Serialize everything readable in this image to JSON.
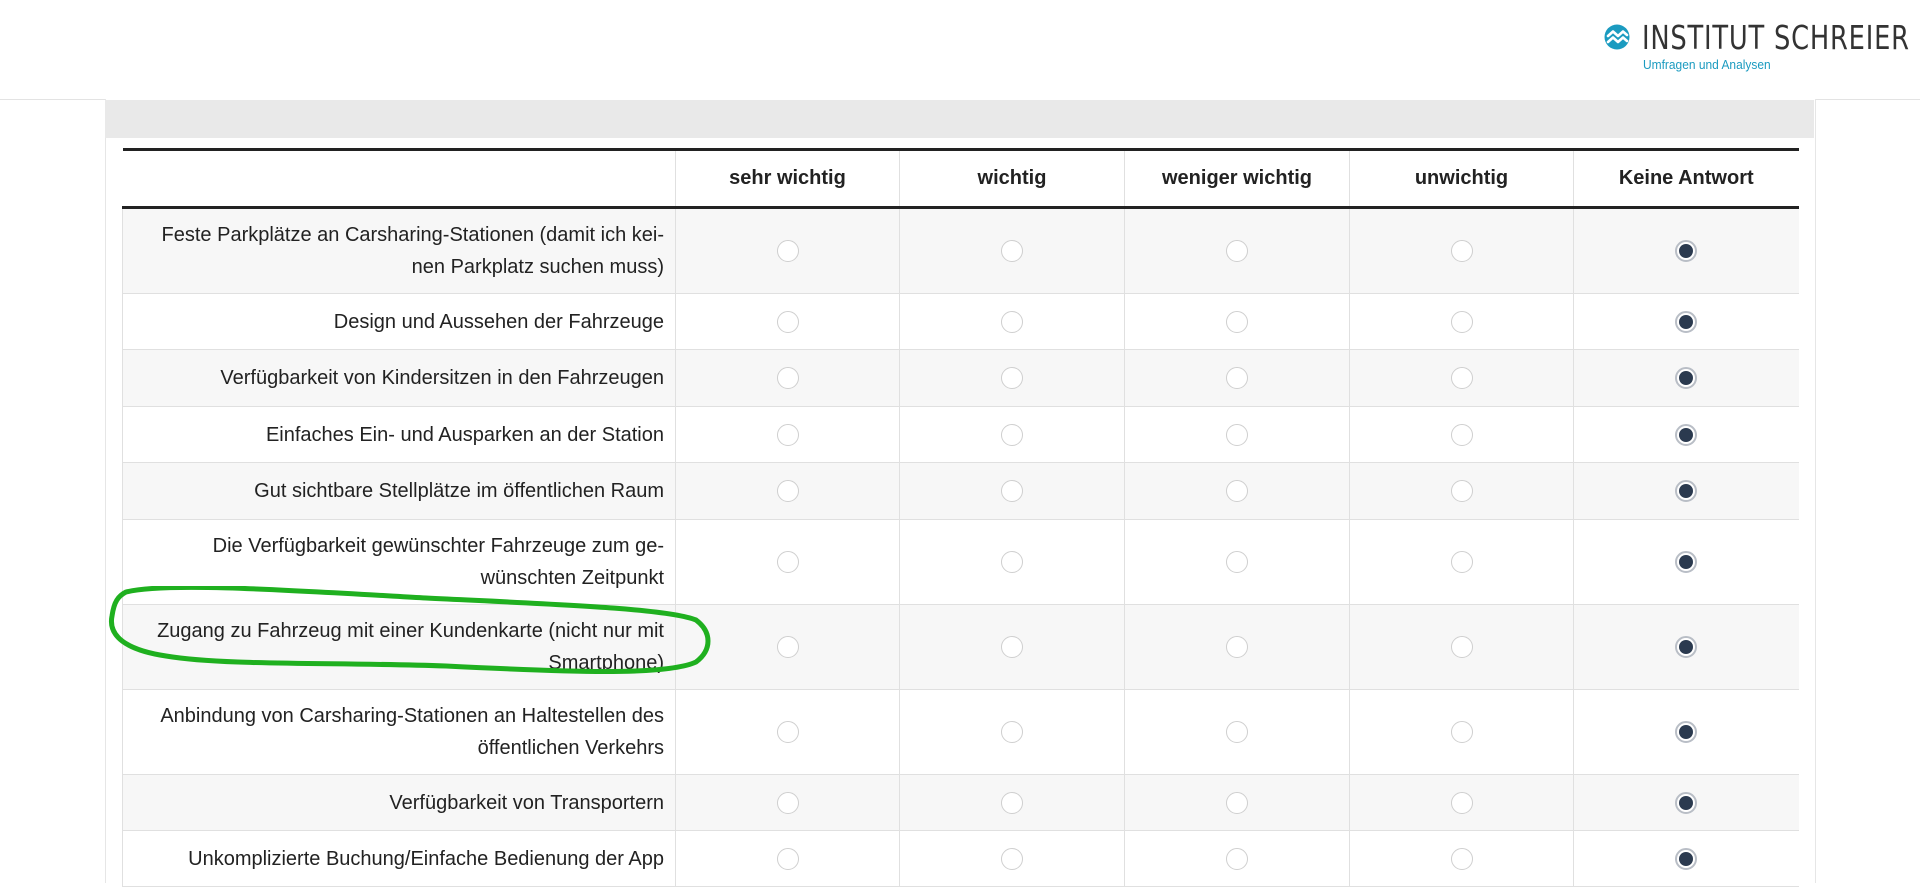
{
  "brand": {
    "name": "INSTITUT SCHREIER",
    "tagline": "Umfragen und Analysen",
    "accent_color": "#1b9bc0",
    "icon": "wave-logo-icon"
  },
  "matrix": {
    "columns": [
      "sehr wichtig",
      "wichtig",
      "weniger wichtig",
      "unwichtig",
      "Keine Antwort"
    ],
    "rows": [
      {
        "label": "Feste Parkplätze an Carsharing-Stationen (damit ich kei­nen Parkplatz suchen muss)",
        "selected": "Keine Antwort"
      },
      {
        "label": "Design und Aussehen der Fahrzeuge",
        "selected": "Keine Antwort"
      },
      {
        "label": "Verfügbarkeit von Kindersitzen in den Fahrzeugen",
        "selected": "Keine Antwort"
      },
      {
        "label": "Einfaches Ein- und Ausparken an der Station",
        "selected": "Keine Antwort"
      },
      {
        "label": "Gut sichtbare Stellplätze im öffentlichen Raum",
        "selected": "Keine Antwort"
      },
      {
        "label": "Die Verfügbarkeit gewünschter Fahrzeuge zum ge­wünschten Zeitpunkt",
        "selected": "Keine Antwort"
      },
      {
        "label": "Zugang zu Fahrzeug mit einer Kundenkarte (nicht nur mit Smartphone)",
        "selected": "Keine Antwort",
        "highlighted": true
      },
      {
        "label": "Anbindung von Carsharing-Stationen an Haltestellen des öffentlichen Verkehrs",
        "selected": "Keine Antwort"
      },
      {
        "label": "Verfügbarkeit von Transportern",
        "selected": "Keine Antwort"
      },
      {
        "label": "Unkomplizierte Buchung/Einfache Bedienung der App",
        "selected": "Keine Antwort"
      }
    ]
  },
  "annotation_color": "#1fb01f"
}
